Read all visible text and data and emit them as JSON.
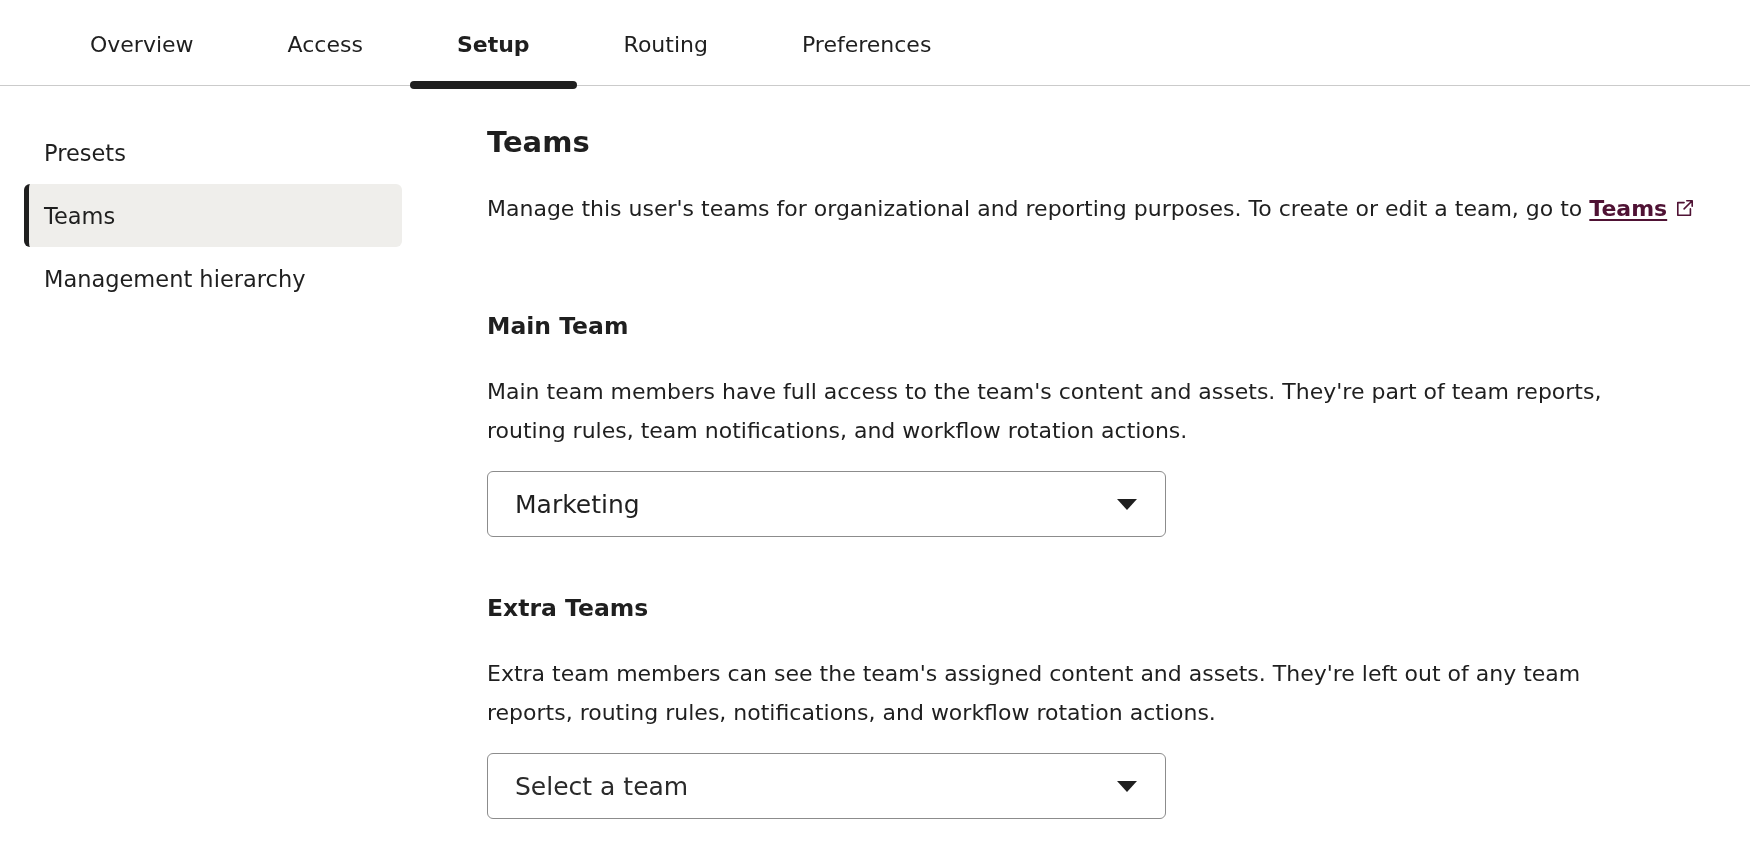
{
  "tabs": [
    {
      "label": "Overview",
      "selected": false
    },
    {
      "label": "Access",
      "selected": false
    },
    {
      "label": "Setup",
      "selected": true
    },
    {
      "label": "Routing",
      "selected": false
    },
    {
      "label": "Preferences",
      "selected": false
    }
  ],
  "sidebar": {
    "items": [
      {
        "label": "Presets",
        "selected": false
      },
      {
        "label": "Teams",
        "selected": true
      },
      {
        "label": "Management hierarchy",
        "selected": false
      }
    ]
  },
  "content": {
    "title": "Teams",
    "description": {
      "text": "Manage this user's teams for organizational and reporting purposes. To create or edit a team, go to ",
      "link": "Teams"
    },
    "sections": [
      {
        "heading": "Main Team",
        "text": "Main team members have full access to the team's content and assets. They're part of team reports, routing rules, team notifications, and workflow rotation actions.",
        "dropdown": {
          "value": "Marketing"
        }
      },
      {
        "heading": "Extra Teams",
        "text": "Extra team members can see the team's assigned content and assets. They're left out of any team reports, routing rules, notifications, and workflow rotation actions.",
        "dropdown": {
          "placeholder": "Select a team"
        }
      }
    ]
  }
}
